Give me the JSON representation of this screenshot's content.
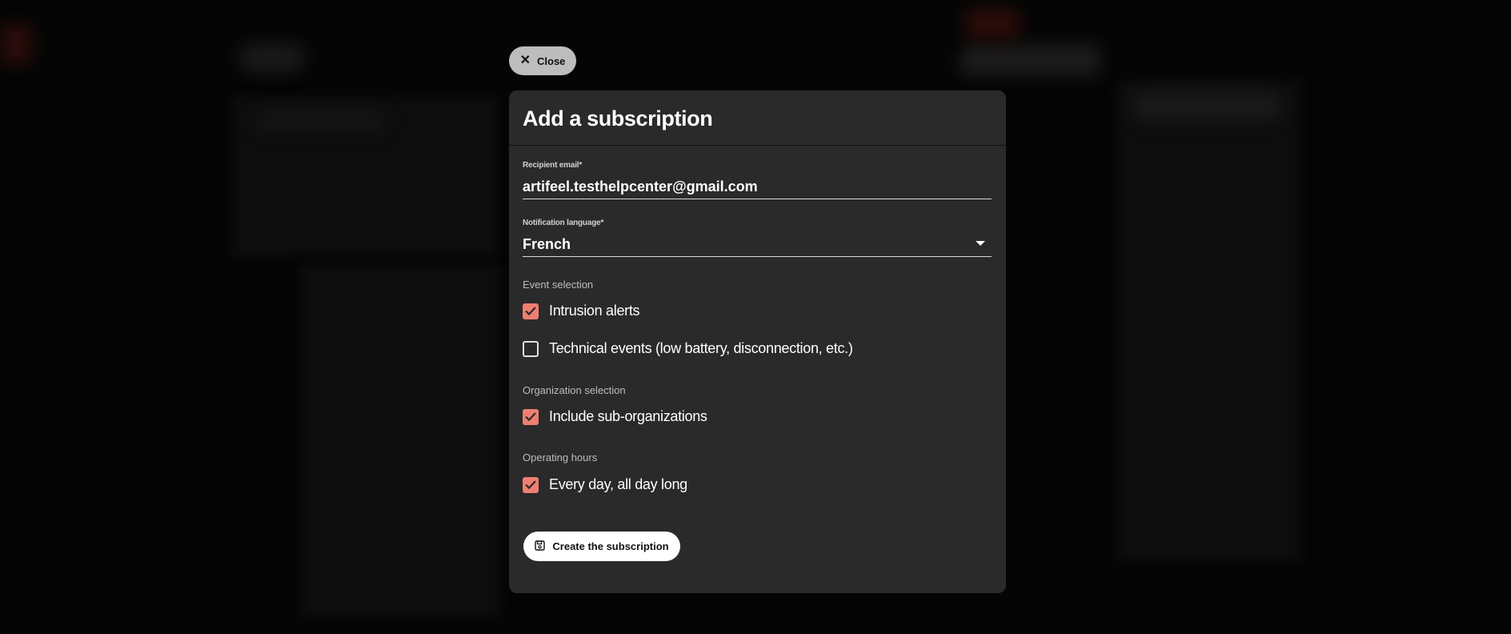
{
  "close_label": "Close",
  "modal": {
    "title": "Add a subscription",
    "recipient": {
      "label": "Recipient email*",
      "value": "artifeel.testhelpcenter@gmail.com"
    },
    "language": {
      "label": "Notification language*",
      "value": "French"
    },
    "event_selection": {
      "label": "Event selection",
      "options": [
        {
          "label": "Intrusion alerts",
          "checked": true
        },
        {
          "label": "Technical events (low battery, disconnection, etc.)",
          "checked": false
        }
      ]
    },
    "organization_selection": {
      "label": "Organization selection",
      "options": [
        {
          "label": "Include sub-organizations",
          "checked": true
        }
      ]
    },
    "operating_hours": {
      "label": "Operating hours",
      "options": [
        {
          "label": "Every day, all day long",
          "checked": true
        }
      ]
    },
    "submit_label": "Create the subscription"
  },
  "colors": {
    "accent": "#ef7e72",
    "modal_bg": "#2a2a2a",
    "overlay": "#050505"
  }
}
